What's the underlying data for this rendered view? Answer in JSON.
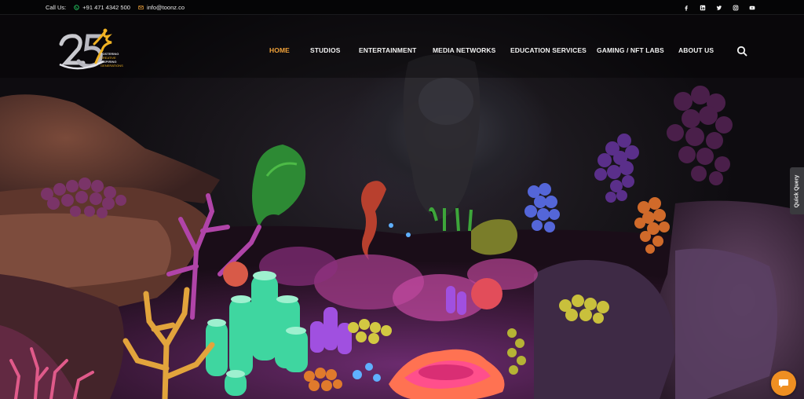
{
  "topbar": {
    "call_label": "Call Us:",
    "phone": "+91 471 4342 500",
    "email": "info@toonz.co",
    "social": [
      {
        "name": "facebook-icon",
        "glyph": "f"
      },
      {
        "name": "linkedin-icon",
        "glyph": "in"
      },
      {
        "name": "twitter-icon",
        "glyph": "t"
      },
      {
        "name": "instagram-icon",
        "glyph": "ig"
      },
      {
        "name": "youtube-icon",
        "glyph": "yt"
      }
    ]
  },
  "logo": {
    "numerals": "25",
    "tagline_lines": [
      "FOSTERING",
      "CREATIVE",
      "INSPIRING",
      "GENERATIONS"
    ]
  },
  "nav": {
    "items": [
      {
        "label": "HOME",
        "active": true
      },
      {
        "label": "STUDIOS",
        "active": false
      },
      {
        "label": "ENTERTAINMENT",
        "active": false
      },
      {
        "label": "MEDIA NETWORKS",
        "active": false
      },
      {
        "label": "EDUCATION SERVICES",
        "active": false
      },
      {
        "label": "GAMING / NFT LABS",
        "active": false
      },
      {
        "label": "ABOUT US",
        "active": false
      }
    ]
  },
  "quick_query": {
    "label": "Quick Query"
  },
  "colors": {
    "accent": "#f2a33a",
    "chat": "#ef8f22",
    "topbar_bg": "#050506"
  }
}
